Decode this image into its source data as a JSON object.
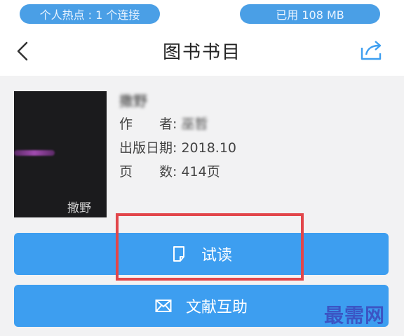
{
  "status_bar": {
    "hotspot_text": "个人热点 : 1 个连接",
    "usage_text": "已用 108 MB"
  },
  "header": {
    "back_icon": "chevron-left-icon",
    "title": "图书书目",
    "share_icon": "share-icon"
  },
  "book": {
    "cover_text": "撒野",
    "name_obscured": "撒野",
    "author_label": "作　　者:",
    "author_value": "巫哲",
    "pub_date_label": "出版日期:",
    "pub_date_value": "2018.10",
    "pages_label": "页　　数:",
    "pages_value": "414页"
  },
  "actions": {
    "trial_read_label": "试读",
    "trial_read_icon": "document-icon",
    "literature_help_label": "文献互助",
    "literature_help_icon": "mail-icon"
  },
  "annotation": {
    "highlight_color": "#e2464a"
  },
  "watermark": "最需网"
}
